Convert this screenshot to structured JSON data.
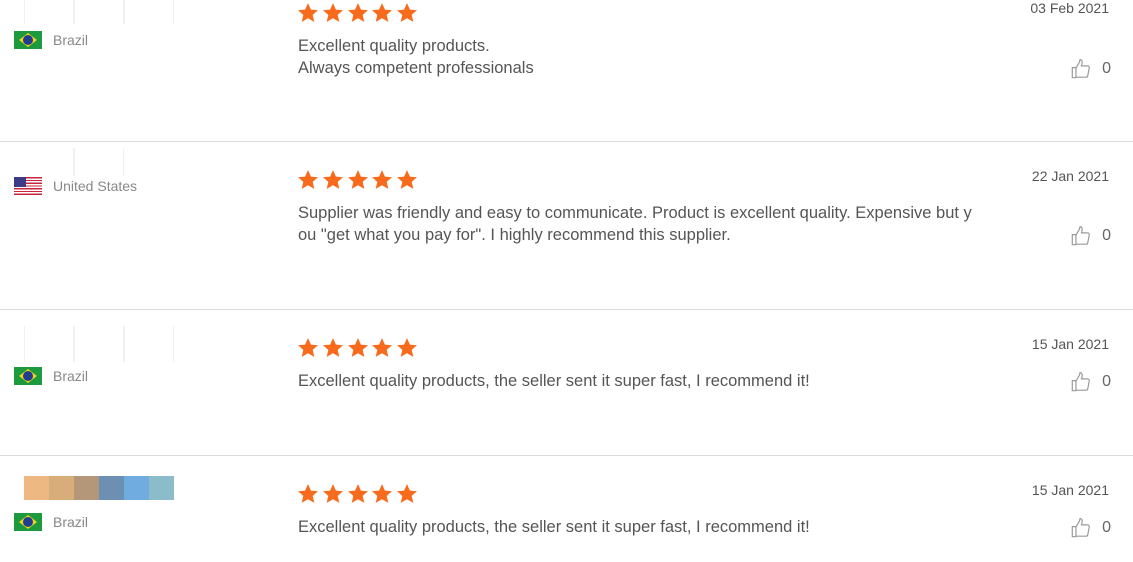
{
  "reviews": [
    {
      "country": "Brazil",
      "flag": "brazil-flag-icon",
      "rating": 5,
      "text_lines": [
        "Excellent quality products.",
        "Always competent professionals"
      ],
      "date": "03 Feb 2021",
      "likes": "0"
    },
    {
      "country": "United States",
      "flag": "us-flag-icon",
      "rating": 5,
      "text_lines": [
        "Supplier was friendly and easy to communicate. Product is excellent quality. Expensive but y",
        "ou \"get what you pay for\". I highly recommend this supplier."
      ],
      "date": "22 Jan 2021",
      "likes": "0"
    },
    {
      "country": "Brazil",
      "flag": "brazil-flag-icon",
      "rating": 5,
      "text_lines": [
        "Excellent quality products, the seller sent it super fast, I recommend it!"
      ],
      "date": "15 Jan 2021",
      "likes": "0"
    },
    {
      "country": "Brazil",
      "flag": "brazil-flag-icon",
      "rating": 5,
      "text_lines": [
        "Excellent quality products, the seller sent it super fast, I recommend it!"
      ],
      "date": "15 Jan 2021",
      "likes": "0"
    }
  ],
  "colors": {
    "star": "#f86b1c",
    "divider": "#dcdcdc",
    "text": "#555555",
    "blurred_thumbs": [
      "#eeb882",
      "#d8ad79",
      "#b39778",
      "#6d8fb2",
      "#71ace0",
      "#8cbcc9"
    ]
  },
  "icons": {
    "star": "star-icon",
    "like": "thumbs-up-icon"
  }
}
